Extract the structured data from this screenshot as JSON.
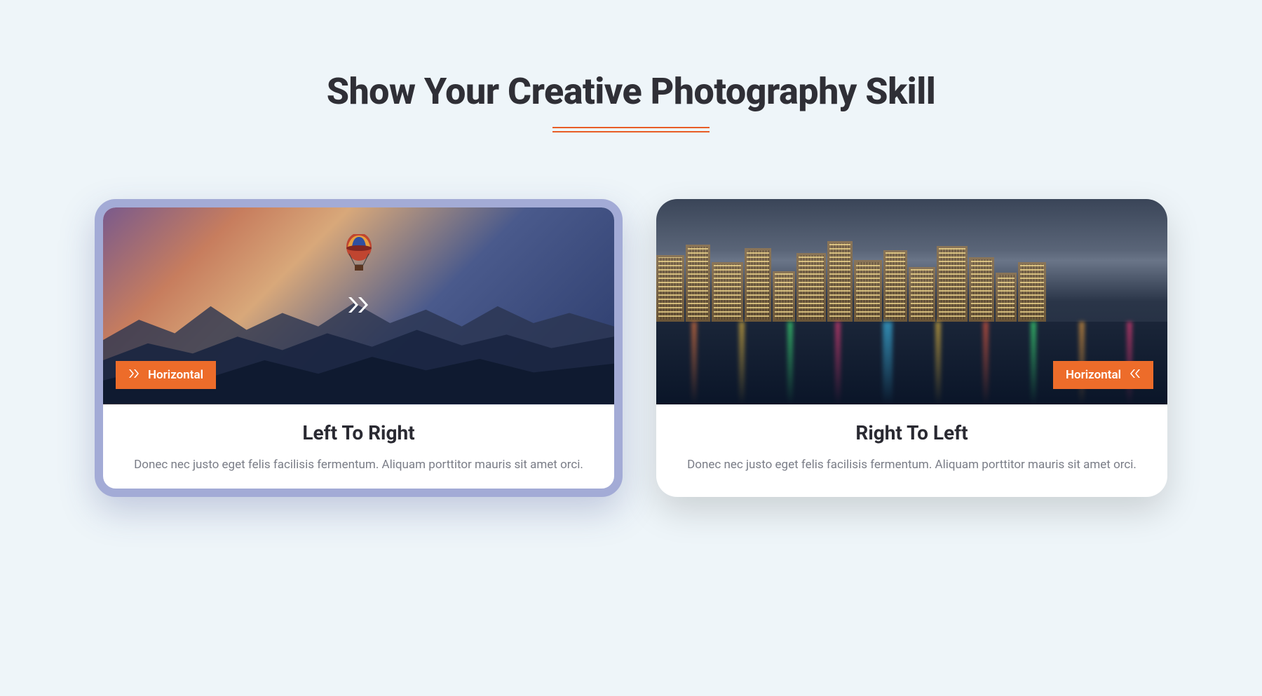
{
  "heading": "Show Your Creative Photography Skill",
  "cards": [
    {
      "badge": "Horizontal",
      "title": "Left To Right",
      "desc": "Donec nec justo eget felis facilisis fermentum. Aliquam porttitor mauris sit amet orci."
    },
    {
      "badge": "Horizontal",
      "title": "Right To Left",
      "desc": "Donec nec justo eget felis facilisis fermentum. Aliquam porttitor mauris sit amet orci."
    }
  ]
}
